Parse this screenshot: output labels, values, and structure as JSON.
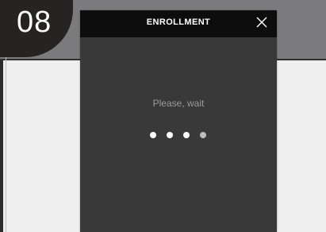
{
  "background": {
    "step_number": "08",
    "colors": {
      "page": "#eeeeee",
      "band": "#7b7b7d",
      "badge": "#262322"
    }
  },
  "dialog": {
    "title": "ENROLLMENT",
    "close_icon": "close-icon",
    "status_text": "Please, wait",
    "loader": {
      "dot_count": 4,
      "active_dots": 3
    },
    "colors": {
      "header": "#0d0d0d",
      "body": "#393939",
      "status_text": "#9a9a9a"
    }
  }
}
